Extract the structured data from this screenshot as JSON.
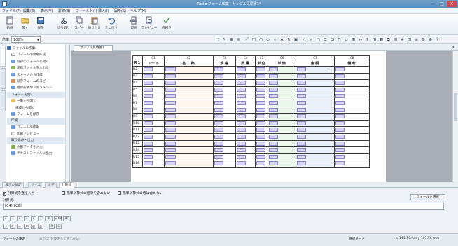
{
  "window": {
    "title": "Radio フォーム編集 - サンプル見積書1*"
  },
  "menu": [
    "ファイル(F)",
    "編集(E)",
    "表示(V)",
    "罫線(B)",
    "フィールド(I)",
    "挿入(I)",
    "図形(S)",
    "ヘルプ(H)"
  ],
  "toolbar": {
    "buttons": [
      {
        "label": "新規",
        "icon": "new-file-icon"
      },
      {
        "label": "開く",
        "icon": "open-folder-icon"
      },
      {
        "label": "保存",
        "icon": "save-icon"
      },
      {
        "label": "切り取り",
        "icon": "cut-icon"
      },
      {
        "label": "コピー",
        "icon": "copy-icon"
      },
      {
        "label": "貼り付け",
        "icon": "paste-icon"
      },
      {
        "label": "元に戻す",
        "icon": "undo-icon"
      },
      {
        "label": "印刷",
        "icon": "print-icon"
      },
      {
        "label": "プレビュー",
        "icon": "preview-icon"
      },
      {
        "label": "点検き",
        "icon": "check-icon"
      }
    ]
  },
  "zoom": {
    "label": "倍率",
    "value": "100%"
  },
  "sidebar": {
    "items": [
      {
        "label": "ファイルの作業",
        "color": "#3b6db3"
      },
      {
        "label": "フォームの新規作成",
        "color": "#eeeeee"
      },
      {
        "label": "既存のフォームを開く",
        "color": "#6b9bd2"
      },
      {
        "label": "連携ファイルを入れる",
        "color": "#8fb35a"
      },
      {
        "label": "スキャナから作成",
        "color": "#6b9bd2"
      },
      {
        "label": "既存フォームのコピー",
        "color": "#d48b5a"
      },
      {
        "label": "他の形式のドキュメント",
        "color": "#6b9bd2"
      },
      {
        "label": "フォームを開く",
        "color": "#dddddd"
      },
      {
        "label": "一覧から開く",
        "color": "#e2c062"
      },
      {
        "label": "構成から開く",
        "color": "#eeeeee"
      },
      {
        "label": "フォームを保存",
        "color": "#6b9bd2"
      },
      {
        "label": "印刷",
        "color": "#dddddd"
      },
      {
        "label": "フォームの印刷",
        "color": "#6b9bd2"
      },
      {
        "label": "印刷プレビュー",
        "color": "#eeeeee"
      },
      {
        "label": "取り込み・出力",
        "color": "#dddddd"
      },
      {
        "label": "外部データを入力",
        "color": "#8fb35a"
      },
      {
        "label": "テキストファイルに出力",
        "color": "#6b9bd2"
      }
    ]
  },
  "doc_tab": {
    "label": "サンプル見積書1"
  },
  "grid": {
    "col_refs": [
      "C1",
      "C2",
      "C3",
      "C4",
      "C5",
      "C6",
      "C7",
      "C8"
    ],
    "headers": [
      "コード",
      "名　称",
      "規格",
      "数量",
      "単位",
      "単価",
      "金額",
      "備考"
    ],
    "row_refs": [
      "R1",
      "R2",
      "R3",
      "R4",
      "R5",
      "R6",
      "R7",
      "R8",
      "R9",
      "R10",
      "R11",
      "R12",
      "R13",
      "R14",
      "R15",
      "R16"
    ]
  },
  "bottom": {
    "tabs": [
      "表示の設定",
      "サイズ",
      "文字",
      "計算式"
    ],
    "active_tab": "計算式",
    "checks": [
      {
        "label": "計算式を直接入力",
        "checked": true
      },
      {
        "label": "簡単計算式の結果を含めない",
        "checked": false
      },
      {
        "label": "簡単計算式の値は含めない",
        "checked": false
      }
    ],
    "calc_label": "計算式:",
    "formula": "[C4]*[C6]",
    "field_settings": "フィールド選択",
    "ops_row1": [
      "+",
      "-",
      "×",
      "÷",
      "(",
      ")",
      "IF",
      "SUM",
      "AC"
    ],
    "ops_row2": [
      "<",
      ">",
      "=",
      "<>",
      "≦",
      "≧",
      "R",
      "C"
    ]
  },
  "status": {
    "left": "フォームの設定",
    "hint": "表示(Z)を設定して表示(Alt)",
    "mode": "選択モード",
    "pos": "x 161.50mm  y 107.55 mm"
  }
}
